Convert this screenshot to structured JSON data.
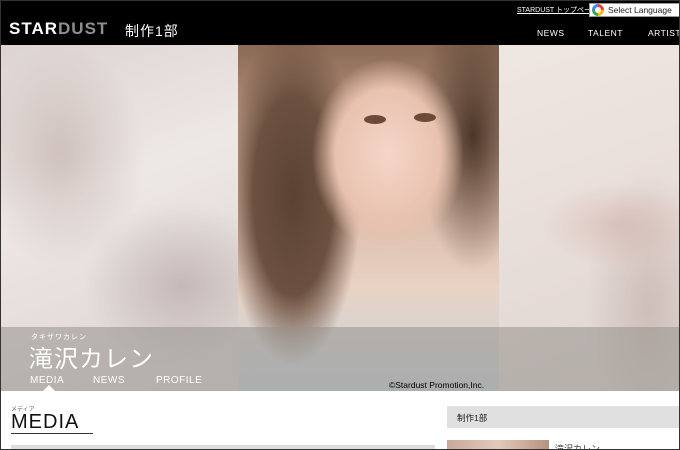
{
  "header": {
    "logo_star": "STAR",
    "logo_dust": "DUST",
    "section": "制作1部",
    "top_link": "STARDUST トップページ",
    "language": "Select Language",
    "nav": [
      "NEWS",
      "TALENT",
      "ARTIST"
    ]
  },
  "hero": {
    "name_kana": "タキザワカレン",
    "name": "滝沢カレン",
    "tabs": [
      "MEDIA",
      "NEWS",
      "PROFILE"
    ],
    "copyright": "©Stardust Promotion,Inc."
  },
  "content": {
    "title_kana": "メディア",
    "title": "MEDIA"
  },
  "sidebar": {
    "heading": "制作1部",
    "item_name": "滝沢カレン"
  }
}
